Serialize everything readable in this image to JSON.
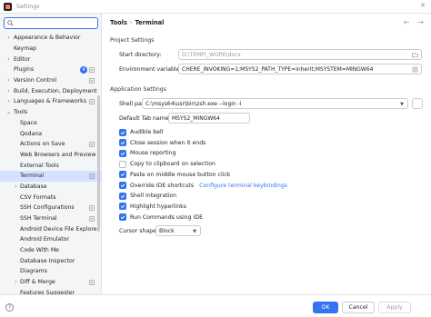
{
  "window": {
    "title": "Settings"
  },
  "sidebar": {
    "search_placeholder": "",
    "items": [
      {
        "label": "Appearance & Behavior",
        "level": 0,
        "arrow": "›"
      },
      {
        "label": "Keymap",
        "level": 0,
        "arrow": ""
      },
      {
        "label": "Editor",
        "level": 0,
        "arrow": "›"
      },
      {
        "label": "Plugins",
        "level": 0,
        "arrow": "",
        "badge": "4"
      },
      {
        "label": "Version Control",
        "level": 0,
        "arrow": "›"
      },
      {
        "label": "Build, Execution, Deployment",
        "level": 0,
        "arrow": "›"
      },
      {
        "label": "Languages & Frameworks",
        "level": 0,
        "arrow": "›"
      },
      {
        "label": "Tools",
        "level": 0,
        "arrow": "⌄"
      },
      {
        "label": "Space",
        "level": 1,
        "arrow": ""
      },
      {
        "label": "Qodana",
        "level": 1,
        "arrow": ""
      },
      {
        "label": "Actions on Save",
        "level": 1,
        "arrow": ""
      },
      {
        "label": "Web Browsers and Preview",
        "level": 1,
        "arrow": ""
      },
      {
        "label": "External Tools",
        "level": 1,
        "arrow": ""
      },
      {
        "label": "Terminal",
        "level": 1,
        "arrow": "",
        "selected": true
      },
      {
        "label": "Database",
        "level": 1,
        "arrow": "›"
      },
      {
        "label": "CSV Formats",
        "level": 1,
        "arrow": ""
      },
      {
        "label": "SSH Configurations",
        "level": 1,
        "arrow": ""
      },
      {
        "label": "SSH Terminal",
        "level": 1,
        "arrow": ""
      },
      {
        "label": "Android Device File Explorer",
        "level": 1,
        "arrow": ""
      },
      {
        "label": "Android Emulator",
        "level": 1,
        "arrow": ""
      },
      {
        "label": "Code With Me",
        "level": 1,
        "arrow": ""
      },
      {
        "label": "Database Inspector",
        "level": 1,
        "arrow": ""
      },
      {
        "label": "Diagrams",
        "level": 1,
        "arrow": ""
      },
      {
        "label": "Diff & Merge",
        "level": 1,
        "arrow": "›"
      },
      {
        "label": "Features Suggester",
        "level": 1,
        "arrow": ""
      }
    ]
  },
  "breadcrumb": {
    "parent": "Tools",
    "separator": "›",
    "current": "Terminal"
  },
  "project_settings": {
    "title": "Project Settings",
    "start_directory_label": "Start directory:",
    "start_directory_value": "D:\\TEMP\\_WORK\\docs",
    "env_vars_label": "Environment variables:",
    "env_vars_value": "CHERE_INVOKING=1;MSYS2_PATH_TYPE=inherit;MSYSTEM=MINGW64"
  },
  "app_settings": {
    "title": "Application Settings",
    "shell_path_label": "Shell path:",
    "shell_path_value": "C:\\msys64\\usr\\bin\\zsh.exe --login -i",
    "tab_name_label": "Default Tab name:",
    "tab_name_value": "MSYS2_MINGW64",
    "checkboxes": [
      {
        "label": "Audible bell",
        "checked": true
      },
      {
        "label": "Close session when it ends",
        "checked": true
      },
      {
        "label": "Mouse reporting",
        "checked": true
      },
      {
        "label": "Copy to clipboard on selection",
        "checked": false
      },
      {
        "label": "Paste on middle mouse button click",
        "checked": true
      },
      {
        "label": "Override IDE shortcuts",
        "checked": true,
        "link": "Configure terminal keybindings"
      },
      {
        "label": "Shell integration",
        "checked": true
      },
      {
        "label": "Highlight hyperlinks",
        "checked": true
      },
      {
        "label": "Run Commands using IDE",
        "checked": true
      }
    ],
    "cursor_shape_label": "Cursor shape:",
    "cursor_shape_value": "Block"
  },
  "footer": {
    "help": "?",
    "ok_label": "OK",
    "cancel_label": "Cancel",
    "apply_label": "Apply"
  },
  "colors": {
    "accent": "#3574f0",
    "selection": "#d4e2ff",
    "sidebar_bg": "#f4f5f7"
  }
}
